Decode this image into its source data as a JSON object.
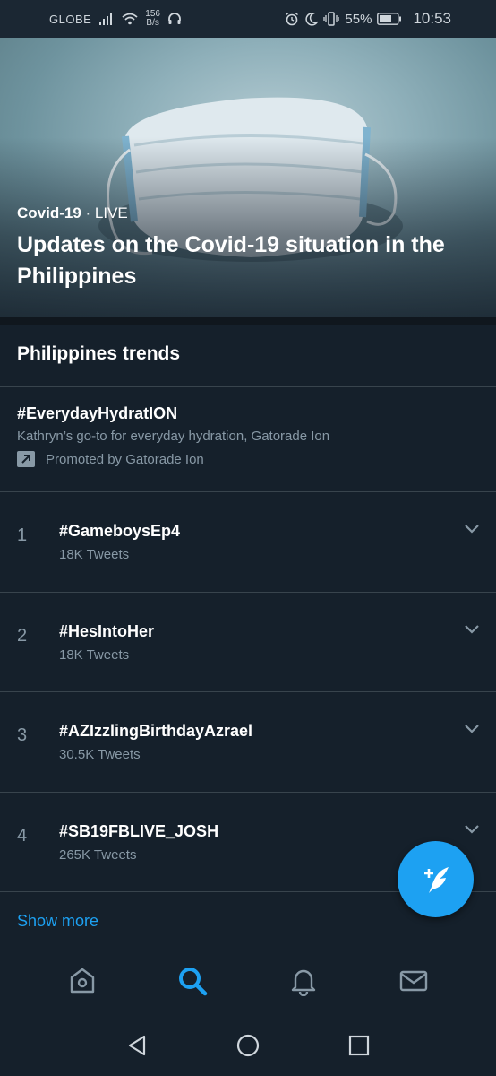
{
  "status_bar": {
    "carrier": "GLOBE",
    "speed_value": "156",
    "speed_unit": "B/s",
    "battery": "55%",
    "time": "10:53"
  },
  "hero": {
    "topic": "Covid-19",
    "separator": " · ",
    "status": "LIVE",
    "title": "Updates on the Covid-19 situation in the Philippines"
  },
  "trends": {
    "section_title": "Philippines trends",
    "promoted": {
      "tag": "#EverydayHydratION",
      "description": "Kathryn’s go-to for everyday hydration, Gatorade Ion",
      "promoted_by": "Promoted by Gatorade Ion"
    },
    "items": [
      {
        "rank": "1",
        "name": "#GameboysEp4",
        "count": "18K Tweets"
      },
      {
        "rank": "2",
        "name": "#HesIntoHer",
        "count": "18K Tweets"
      },
      {
        "rank": "3",
        "name": "#AZIzzlingBirthdayAzrael",
        "count": "30.5K Tweets"
      },
      {
        "rank": "4",
        "name": "#SB19FBLIVE_JOSH",
        "count": "265K Tweets"
      }
    ],
    "show_more": "Show more"
  },
  "tabs": [
    {
      "icon": "home-icon",
      "active": false
    },
    {
      "icon": "search-icon",
      "active": true
    },
    {
      "icon": "bell-icon",
      "active": false
    },
    {
      "icon": "mail-icon",
      "active": false
    }
  ],
  "colors": {
    "background": "#15202b",
    "accent": "#1da1f2",
    "secondary_text": "#8899a6",
    "divider": "#38444d"
  }
}
